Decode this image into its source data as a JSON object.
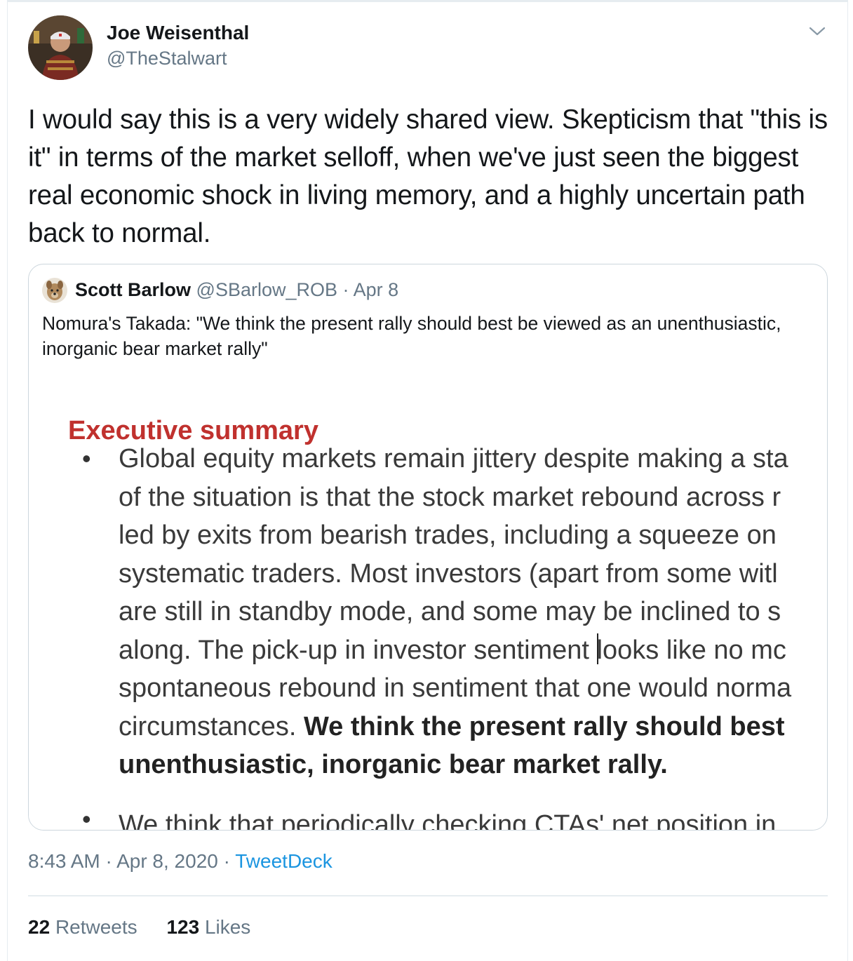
{
  "tweet": {
    "author_name": "Joe Weisenthal",
    "author_handle": "@TheStalwart",
    "text": "I would say this is a very widely shared view. Skepticism that \"this is it\" in terms of the market selloff, when we've just seen the biggest real economic shock in living memory, and a highly uncertain path back to normal.",
    "icon": "chevron-down-icon"
  },
  "quoted": {
    "author_name": "Scott Barlow",
    "author_handle": "@SBarlow_ROB",
    "separator": "·",
    "date": "Apr 8",
    "text": "Nomura's Takada: \"We think the present rally should best be viewed as an unenthusiastic, inorganic bear market rally\"",
    "image": {
      "heading": "Executive summary",
      "bullet": "•",
      "lines": [
        "Global equity markets remain jittery despite making a sta",
        "of the situation is that the stock market rebound across r",
        "led by exits from bearish trades, including a squeeze on",
        "systematic traders. Most investors (apart from some witl",
        "are still in standby mode, and some may be inclined to s"
      ],
      "line6_before_cursor": "along. The pick-up in investor sentiment ",
      "line6_after_cursor": "looks like no mc",
      "line7": "spontaneous rebound in sentiment that one would norma",
      "line8_normal": "circumstances. ",
      "line8_bold": "We think the present rally should best",
      "line9_bold": "unenthusiastic, inorganic bear market rally.",
      "cut_line": "We think that periodically checking CTAs' net position in"
    }
  },
  "meta": {
    "time": "8:43 AM",
    "sep1": "·",
    "date": "Apr 8, 2020",
    "sep2": "·",
    "source": "TweetDeck"
  },
  "stats": {
    "retweets_count": "22",
    "retweets_label": "Retweets",
    "likes_count": "123",
    "likes_label": "Likes"
  },
  "colors": {
    "text": "#14171a",
    "muted": "#657786",
    "link": "#1b95e0",
    "border": "#ccd6dd",
    "doc_heading": "#c0312e"
  }
}
